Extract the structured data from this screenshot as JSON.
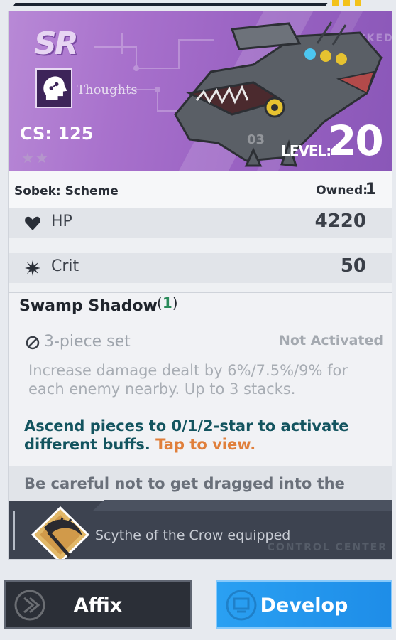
{
  "card": {
    "rarity": "SR",
    "category": "Thoughts",
    "cs_text": "CS: 125",
    "stars": "★★",
    "level_label": "LEVEL:",
    "level": "20",
    "serial": "03",
    "locked_watermark": "LOCKED",
    "name": "Sobek: Scheme",
    "owned_label": "Owned:",
    "owned": "1"
  },
  "stats": [
    {
      "icon": "heart-icon",
      "label": "HP",
      "value": "4220"
    },
    {
      "icon": "crit-burst-icon",
      "label": "Crit",
      "value": "50"
    }
  ],
  "set": {
    "name": "Swamp Shadow",
    "count_open": "(",
    "count": "1",
    "count_close": ")",
    "piece_label": "3-piece set",
    "status": "Not Activated",
    "description": "Increase damage dealt by 6%/7.5%/9% for each enemy nearby. Up to 3 stacks.",
    "ascend_text": "Ascend pieces to 0/1/2-star to activate different buffs.",
    "tap_text": "Tap to view.",
    "flavor": "Be careful not to get dragged into the"
  },
  "equip": {
    "label": "Scythe of the Crow equipped",
    "watermark": "CONTROL CENTER"
  },
  "buttons": {
    "affix": "Affix",
    "develop": "Develop"
  },
  "colors": {
    "banner": "#a871cc",
    "develop": "#1e8de8",
    "affix": "#2b2f37",
    "accent_tap": "#e07f3b",
    "ascend_text": "#13545f",
    "set_count": "#2a8a5a"
  }
}
